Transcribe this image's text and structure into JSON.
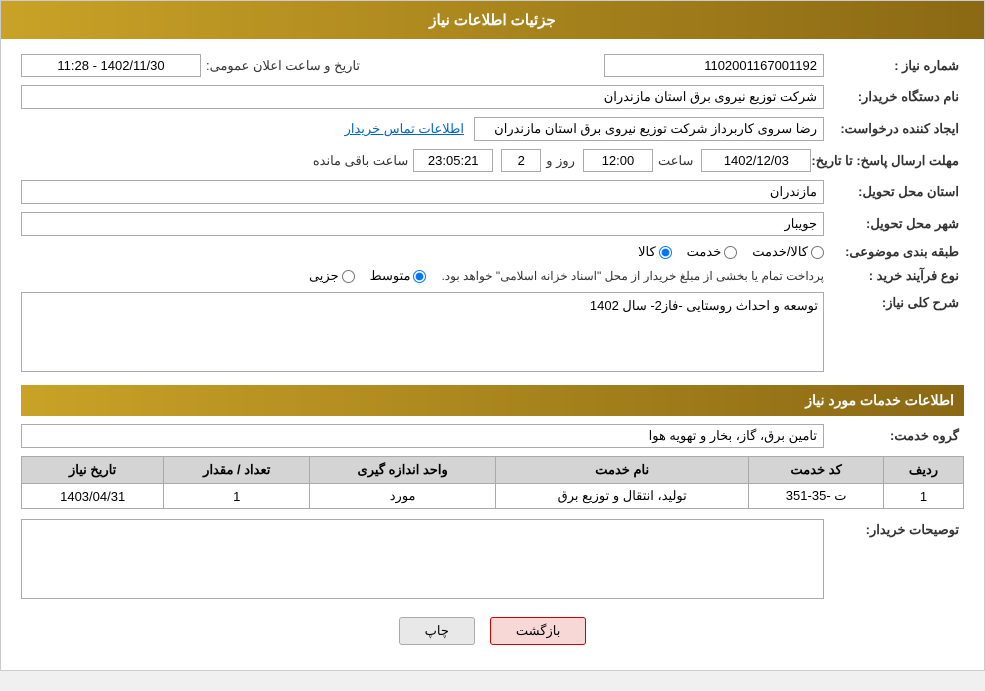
{
  "header": {
    "title": "جزئیات اطلاعات نیاز"
  },
  "fields": {
    "need_number_label": "شماره نیاز :",
    "need_number_value": "1102001167001192",
    "announce_date_label": "تاریخ و ساعت اعلان عمومی:",
    "announce_date_value": "1402/11/30 - 11:28",
    "buyer_org_label": "نام دستگاه خریدار:",
    "buyer_org_value": "شرکت توزیع نیروی برق استان مازندران",
    "creator_label": "ایجاد کننده درخواست:",
    "creator_value": "رضا سروی کاربرداز شرکت توزیع نیروی برق استان مازندران",
    "contact_link": "اطلاعات تماس خریدار",
    "deadline_label": "مهلت ارسال پاسخ: تا تاریخ:",
    "deadline_date": "1402/12/03",
    "deadline_time_label": "ساعت",
    "deadline_time": "12:00",
    "deadline_day_label": "روز و",
    "deadline_days": "2",
    "deadline_remaining_label": "ساعت باقی مانده",
    "deadline_remaining": "23:05:21",
    "delivery_province_label": "استان محل تحویل:",
    "delivery_province_value": "مازندران",
    "delivery_city_label": "شهر محل تحویل:",
    "delivery_city_value": "جویبار",
    "category_label": "طبقه بندی موضوعی:",
    "category_options": [
      "کالا",
      "خدمت",
      "کالا/خدمت"
    ],
    "category_selected": "کالا",
    "purchase_type_label": "نوع فرآیند خرید :",
    "purchase_type_options": [
      "جزیی",
      "متوسط",
      "پرداخت تمام یا بخشی از مبلغ خریدار از محل \"اسناد خزانه اسلامی\" خواهد بود."
    ],
    "purchase_type_selected": "متوسط",
    "description_label": "شرح کلی نیاز:",
    "description_value": "توسعه و احداث روستایی -فاز2- سال 1402",
    "service_section_title": "اطلاعات خدمات مورد نیاز",
    "service_group_label": "گروه خدمت:",
    "service_group_value": "تامین برق، گاز، بخار و تهویه هوا",
    "table": {
      "columns": [
        "ردیف",
        "کد خدمت",
        "نام خدمت",
        "واحد اندازه گیری",
        "تعداد / مقدار",
        "تاریخ نیاز"
      ],
      "rows": [
        {
          "row": "1",
          "code": "ت -35-351",
          "name": "تولید، انتقال و توزیع برق",
          "unit": "مورد",
          "quantity": "1",
          "date": "1403/04/31"
        }
      ]
    },
    "buyer_desc_label": "توصیحات خریدار:"
  },
  "buttons": {
    "print": "چاپ",
    "back": "بازگشت"
  }
}
